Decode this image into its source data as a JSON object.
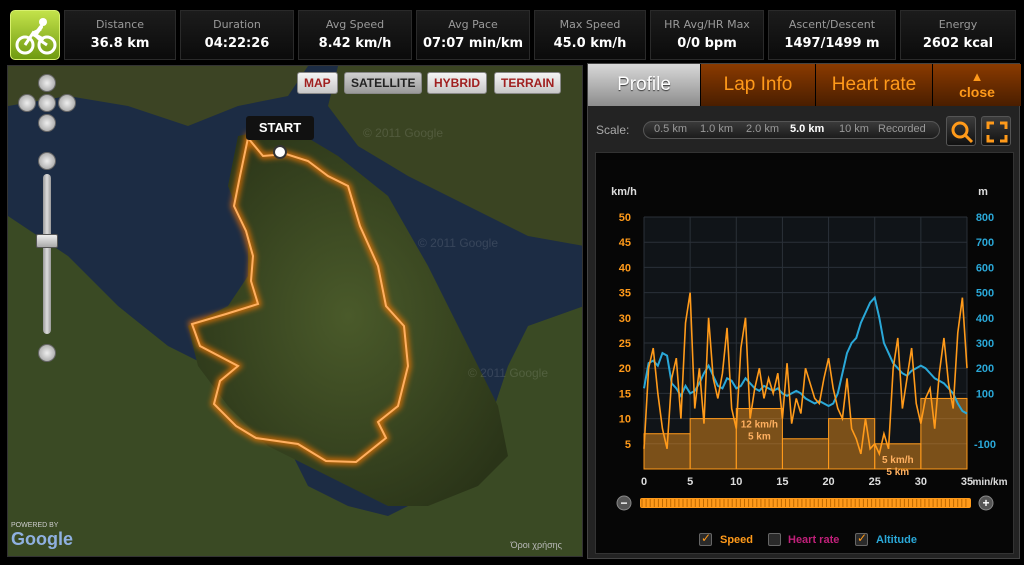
{
  "stats": [
    {
      "label": "Distance",
      "value": "36.8 km"
    },
    {
      "label": "Duration",
      "value": "04:22:26"
    },
    {
      "label": "Avg Speed",
      "value": "8.42 km/h"
    },
    {
      "label": "Avg Pace",
      "value": "07:07 min/km"
    },
    {
      "label": "Max Speed",
      "value": "45.0 km/h"
    },
    {
      "label": "HR Avg/HR Max",
      "value": "0/0 bpm"
    },
    {
      "label": "Ascent/Descent",
      "value": "1497/1499 m"
    },
    {
      "label": "Energy",
      "value": "2602 kcal"
    }
  ],
  "map": {
    "types": [
      "MAP",
      "SATELLITE",
      "HYBRID",
      "TERRAIN"
    ],
    "active_type": "SATELLITE",
    "start_label": "START",
    "powered_by": "POWERED BY",
    "google": "Google",
    "attribution": "Όροι χρήσης",
    "watermark": "© 2011 Google"
  },
  "tabs": {
    "profile": "Profile",
    "lap_info": "Lap Info",
    "heart_rate": "Heart rate",
    "close": "close"
  },
  "scale": {
    "label": "Scale:",
    "options": [
      "0.5 km",
      "1.0 km",
      "2.0 km",
      "5.0 km",
      "10 km",
      "Recorded"
    ],
    "active": "5.0 km"
  },
  "legend": {
    "speed": "Speed",
    "heart_rate": "Heart rate",
    "altitude": "Altitude"
  },
  "colors": {
    "speed": "#ff9a1a",
    "altitude": "#2aa8d8",
    "heart_rate": "#c0207a",
    "route": "#ff7a00"
  },
  "chart_data": {
    "type": "line",
    "xlabel": "min/km",
    "ylabel_left": "km/h",
    "ylabel_right": "m",
    "x_ticks": [
      0,
      5,
      10,
      15,
      20,
      25,
      30,
      35
    ],
    "y_left_ticks": [
      5,
      10,
      15,
      20,
      25,
      30,
      35,
      40,
      45,
      50
    ],
    "y_right_ticks": [
      -100,
      100,
      200,
      300,
      400,
      500,
      600,
      700,
      800
    ],
    "xlim": [
      0,
      35
    ],
    "ylim_left": [
      0,
      50
    ],
    "ylim_right": [
      -200,
      800
    ],
    "grid": true,
    "legend_position": "bottom",
    "lap_bars": [
      {
        "x0": 0,
        "x1": 5,
        "value": 7
      },
      {
        "x0": 5,
        "x1": 10,
        "value": 10
      },
      {
        "x0": 10,
        "x1": 15,
        "value": 12,
        "label1": "12 km/h",
        "label2": "5 km"
      },
      {
        "x0": 15,
        "x1": 20,
        "value": 6
      },
      {
        "x0": 20,
        "x1": 25,
        "value": 10
      },
      {
        "x0": 25,
        "x1": 30,
        "value": 5,
        "label1": "5 km/h",
        "label2": "5 km"
      },
      {
        "x0": 30,
        "x1": 35,
        "value": 14
      }
    ],
    "series": [
      {
        "name": "Speed",
        "axis": "left",
        "x": [
          0,
          0.5,
          1,
          1.5,
          2,
          2.5,
          3,
          3.5,
          4,
          4.5,
          5,
          5.5,
          6,
          6.5,
          7,
          7.5,
          8,
          8.5,
          9,
          9.5,
          10,
          10.5,
          11,
          11.5,
          12,
          12.5,
          13,
          13.5,
          14,
          14.5,
          15,
          15.5,
          16,
          16.5,
          17,
          17.5,
          18,
          18.5,
          19,
          19.5,
          20,
          20.5,
          21,
          21.5,
          22,
          22.5,
          23,
          23.5,
          24,
          24.5,
          25,
          25.5,
          26,
          26.5,
          27,
          27.5,
          28,
          28.5,
          29,
          29.5,
          30,
          30.5,
          31,
          31.5,
          32,
          32.5,
          33,
          33.5,
          34,
          34.5,
          35
        ],
        "values": [
          4,
          20,
          24,
          15,
          8,
          4,
          18,
          22,
          10,
          29,
          35,
          12,
          20,
          9,
          30,
          18,
          14,
          19,
          28,
          12,
          8,
          24,
          30,
          10,
          16,
          20,
          14,
          18,
          15,
          19,
          10,
          21,
          9,
          14,
          11,
          20,
          17,
          14,
          13,
          18,
          22,
          16,
          12,
          10,
          18,
          8,
          6,
          3,
          10,
          4,
          5,
          3,
          7,
          4,
          20,
          26,
          12,
          18,
          24,
          13,
          9,
          14,
          16,
          8,
          19,
          26,
          17,
          12,
          27,
          34,
          20
        ]
      },
      {
        "name": "Altitude",
        "axis": "right",
        "x": [
          0,
          0.5,
          1,
          1.5,
          2,
          2.5,
          3,
          3.5,
          4,
          4.5,
          5,
          5.5,
          6,
          6.5,
          7,
          7.5,
          8,
          8.5,
          9,
          9.5,
          10,
          10.5,
          11,
          11.5,
          12,
          12.5,
          13,
          13.5,
          14,
          14.5,
          15,
          15.5,
          16,
          16.5,
          17,
          17.5,
          18,
          18.5,
          19,
          19.5,
          20,
          20.5,
          21,
          21.5,
          22,
          22.5,
          23,
          23.5,
          24,
          24.5,
          25,
          25.5,
          26,
          26.5,
          27,
          27.5,
          28,
          28.5,
          29,
          29.5,
          30,
          30.5,
          31,
          31.5,
          32,
          32.5,
          33,
          33.5,
          34,
          34.5,
          35
        ],
        "values": [
          120,
          220,
          230,
          210,
          260,
          250,
          140,
          120,
          90,
          130,
          100,
          110,
          140,
          180,
          210,
          170,
          130,
          120,
          160,
          150,
          120,
          130,
          160,
          140,
          120,
          110,
          130,
          120,
          110,
          120,
          100,
          90,
          100,
          110,
          100,
          80,
          70,
          60,
          70,
          60,
          50,
          60,
          100,
          180,
          260,
          300,
          320,
          380,
          420,
          460,
          480,
          400,
          300,
          260,
          220,
          200,
          180,
          170,
          190,
          200,
          210,
          200,
          180,
          160,
          150,
          140,
          120,
          100,
          60,
          30,
          20
        ]
      }
    ]
  }
}
